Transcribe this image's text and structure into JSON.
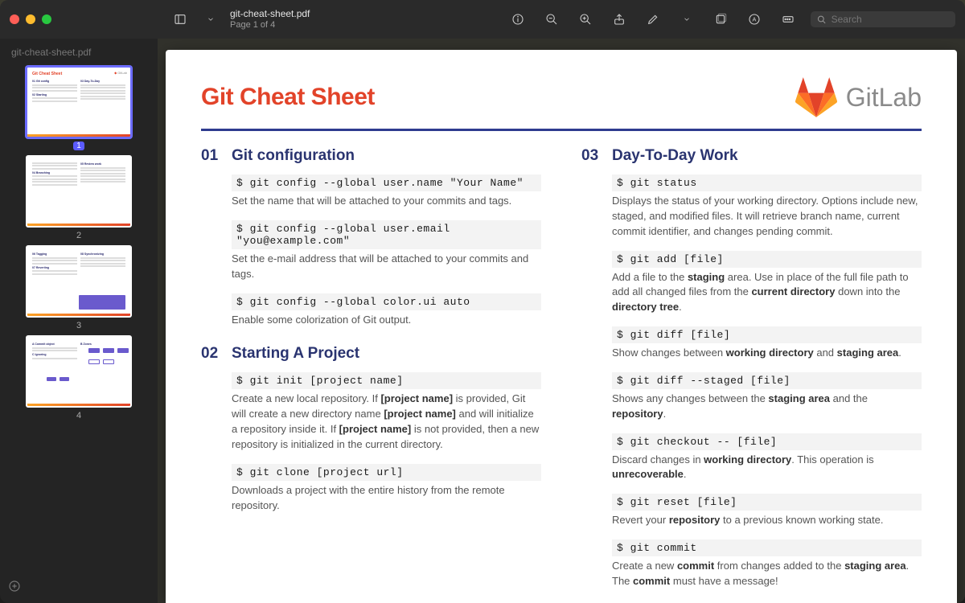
{
  "window": {
    "filename": "git-cheat-sheet.pdf",
    "page_indicator": "Page 1 of 4",
    "search_placeholder": "Search"
  },
  "sidebar": {
    "title": "git-cheat-sheet.pdf",
    "thumbs": [
      {
        "num": "1",
        "active": true
      },
      {
        "num": "2",
        "active": false
      },
      {
        "num": "3",
        "active": false
      },
      {
        "num": "4",
        "active": false
      }
    ]
  },
  "doc": {
    "title": "Git Cheat Sheet",
    "brand": "GitLab",
    "sections": [
      {
        "num": "01",
        "title": "Git configuration",
        "entries": [
          {
            "cmd": "$ git config --global user.name \"Your Name\"",
            "desc": "Set the name that will be attached to your commits and tags."
          },
          {
            "cmd": "$ git config --global user.email \"you@example.com\"",
            "desc": "Set the e-mail address that will be attached to your commits and tags."
          },
          {
            "cmd": "$ git config --global color.ui auto",
            "desc": "Enable some colorization of Git output."
          }
        ]
      },
      {
        "num": "02",
        "title": "Starting A Project",
        "entries": [
          {
            "cmd": "$ git init [project name]",
            "desc": "Create a new local repository. If <b>[project name]</b> is provided, Git will create a new directory name <b>[project name]</b> and will initialize a repository inside it. If <b>[project name]</b> is not provided, then a new repository is initialized in the current directory."
          },
          {
            "cmd": "$ git clone [project url]",
            "desc": "Downloads a project with the entire history from the remote repository."
          }
        ]
      },
      {
        "num": "03",
        "title": "Day-To-Day Work",
        "entries": [
          {
            "cmd": "$ git status",
            "desc": "Displays the status of your working directory. Options include new, staged, and modified files. It will retrieve branch name, current commit identifier, and changes pending commit."
          },
          {
            "cmd": "$ git add [file]",
            "desc": "Add a file to the <b>staging</b> area. Use in place of the full file path to add all changed files from the <b>current directory</b> down into the <b>directory tree</b>."
          },
          {
            "cmd": "$ git diff [file]",
            "desc": "Show changes between <b>working directory</b> and <b>staging area</b>."
          },
          {
            "cmd": "$ git diff --staged [file]",
            "desc": "Shows any changes between the <b>staging area</b> and the <b>repository</b>."
          },
          {
            "cmd": "$ git checkout -- [file]",
            "desc": "Discard changes in <b>working directory</b>. This operation is <b>unrecoverable</b>."
          },
          {
            "cmd": "$ git reset [file]",
            "desc": "Revert your <b>repository</b> to a previous known working state."
          },
          {
            "cmd": "$ git commit",
            "desc": "Create a new <b>commit</b> from changes added to the <b>staging area</b>. The <b>commit</b> must have a message!"
          }
        ]
      }
    ]
  }
}
